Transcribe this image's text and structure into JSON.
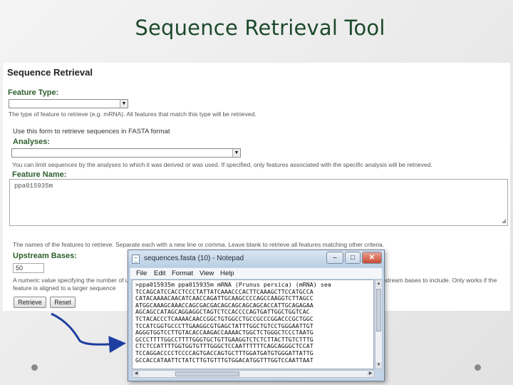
{
  "slide": {
    "title": "Sequence Retrieval Tool"
  },
  "form": {
    "heading": "Sequence Retrieval",
    "feature_type": {
      "label": "Feature Type:",
      "value": "",
      "help": "The type of feature to retrieve (e.g. mRNA). All features that match this type will be retrieved."
    },
    "intro": "Use this form to retrieve sequences in FASTA format",
    "analyses": {
      "label": "Analyses:",
      "value": "",
      "help": "You can limit sequences by the analyses to which it was derived or was used. If specified, only features associated with the specific analysis will be retrieved."
    },
    "feature_name": {
      "label": "Feature Name:",
      "value": "ppa015935m",
      "help": "The names of the features to retrieve. Separate each with a new line or comma. Leave blank to retrieve all features matching other criteria."
    },
    "upstream": {
      "label": "Upstream Bases:",
      "value": "50",
      "help_line1": "A numeric value specifying the number of ups",
      "help_tail": "stream bases to include. Only works if the",
      "help_line2": "feature is aligned to a larger sequence"
    },
    "buttons": {
      "retrieve": "Retrieve",
      "reset": "Reset"
    }
  },
  "notepad": {
    "title": "sequences.fasta (10) - Notepad",
    "controls": {
      "minimize": "–",
      "maximize": "□",
      "close": "✕"
    },
    "menu": [
      "File",
      "Edit",
      "Format",
      "View",
      "Help"
    ],
    "lines": [
      ">ppa015935m ppa015935m mRNA (Prunus persica) (mRNA) sea",
      "TCCAGCATCCACCTCCCTATTATCAAACCCACTTCAAAGCTTCCATGCCA",
      "CATACAAAACAACATCAACCAGATTGCAAGCCCCAGCCAAGGTCTTAGCC",
      "ATGGCAAAGCAAACCAGCGACGACAGCAGCAGCAGCACCATTGCAGAGAA",
      "AGCAGCCATAGCAGGAGGCTAGTCTCCACCCCAGTGATTGGCTGGTCAC",
      "TCTACACCCTCAAAACAACCGGCTGTGGCCTGCCGCCCGGACCCGCTGGC",
      "TCCATCGGTGCCCTTGAAGGCGTGAGCTATTTGGCTGTCCTGGGAATTGT",
      "AGGGTGGTCCTTGTACACCAAGACCAAAACTGGCTCTGGGCTCCCTAATG",
      "GCCCTTTTGGCCTTTTGGGTGCTGTTGAAGGTCTCTCTTACTTGTCTTTG",
      "CTCTCCATTTTGGTGGTGTTTGGGCTCCAATTTTTTCAGCAGGGCTCCAT",
      "TCCAGGACCCCTCCCCAGTGACCAGTGCTTTGGATGATGTGGGATTATTG",
      "GCCACCATAATTCTATCTTGTGTTTGTGGACATGGTTTGGTCCAATTAAT"
    ]
  },
  "colors": {
    "title_text": "#1d4a2c",
    "form_label": "#2e5f2e",
    "arrow": "#1f3fa0",
    "notepad_frame": "#c4d5e8"
  },
  "icons": [
    "notepad-icon",
    "dropdown-arrow-icon",
    "curved-arrow",
    "bullet-dot"
  ]
}
